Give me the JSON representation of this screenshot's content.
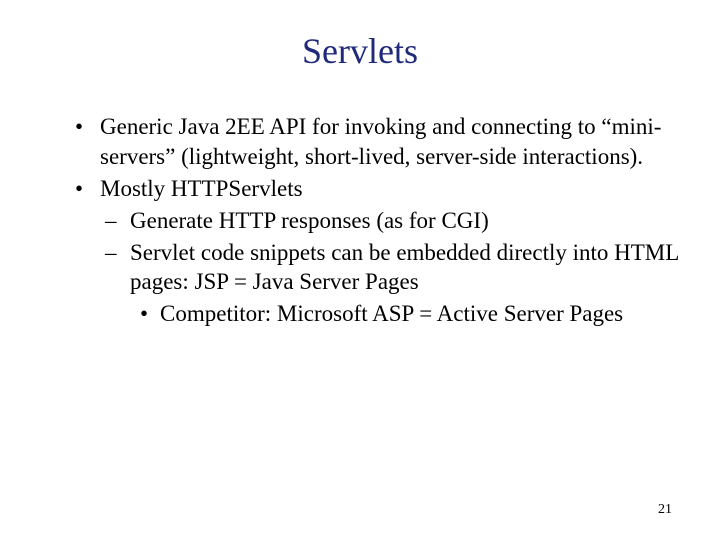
{
  "title": "Servlets",
  "bullets": {
    "b1": "Generic Java 2EE API for invoking and connecting to “mini-servers” (lightweight, short-lived, server-side interactions).",
    "b2": "Mostly HTTPServlets",
    "b2_1": "Generate HTTP responses (as for CGI)",
    "b2_2": "Servlet code snippets can be embedded directly into HTML pages: JSP = Java Server Pages",
    "b2_2_1": "Competitor: Microsoft ASP = Active Server Pages"
  },
  "page_number": "21"
}
